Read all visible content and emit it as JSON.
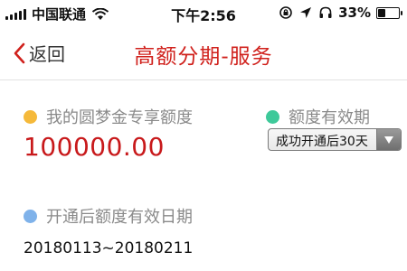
{
  "status_bar": {
    "carrier": "中国联通",
    "time": "下午2:56",
    "battery": "33%",
    "battery_level": 0.33,
    "icons": [
      "signal-icon",
      "wifi-icon",
      "lock-rotation-icon",
      "location-icon",
      "headphones-icon",
      "battery-icon"
    ]
  },
  "header": {
    "back_label": "返回",
    "title": "高额分期-服务"
  },
  "quota": {
    "label": "我的圆梦金专享额度",
    "amount": "100000.00",
    "dot_color": "#f5b93a",
    "amount_color": "#c8191b"
  },
  "validity": {
    "label": "额度有效期",
    "dot_color": "#3ec99a",
    "select_value": "成功开通后30天"
  },
  "effective_period": {
    "label": "开通后额度有效日期",
    "dot_color": "#7fb2ea",
    "dates": "20180113~20180211"
  },
  "colors": {
    "accent": "#d0211c",
    "label_gray": "#8a8a8a"
  }
}
